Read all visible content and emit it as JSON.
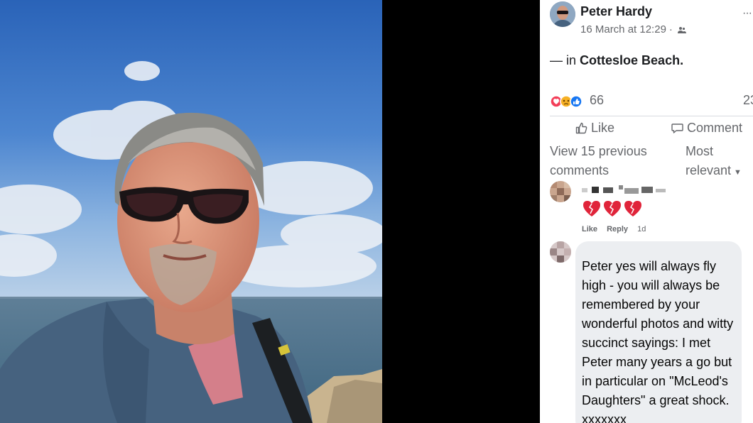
{
  "post": {
    "author": "Peter Hardy",
    "timestamp": "16 March at 12:29",
    "separator": "·",
    "location_prefix": "— in",
    "location_place": "Cottesloe Beach.",
    "reaction_count": "66",
    "comment_count": "23",
    "more_label": "···"
  },
  "actions": {
    "like_label": "Like",
    "comment_label": "Comment"
  },
  "comments_section": {
    "view_previous": "View 15 previous comments",
    "sort_label": "Most relevant"
  },
  "comments": [
    {
      "author": "(blurred)",
      "emoji": "💔💔💔",
      "like_label": "Like",
      "reply_label": "Reply",
      "age": "1d"
    },
    {
      "author": "(blurred)",
      "text": "Peter yes will always fly high - you will always be remembered by your wonderful photos and witty succinct sayings: I met Peter many years a go but in particular on \"McLeod's Daughters\" a great shock. xxxxxxx"
    }
  ],
  "colors": {
    "facebook_blue": "#1877f2",
    "text_secondary": "#65676b",
    "bubble_bg": "#eceef1",
    "broken_heart_red": "#e0243a"
  },
  "icons": [
    "more-icon",
    "audience-icon",
    "like-icon",
    "comment-icon",
    "broken-heart-icon",
    "reaction-icons"
  ]
}
